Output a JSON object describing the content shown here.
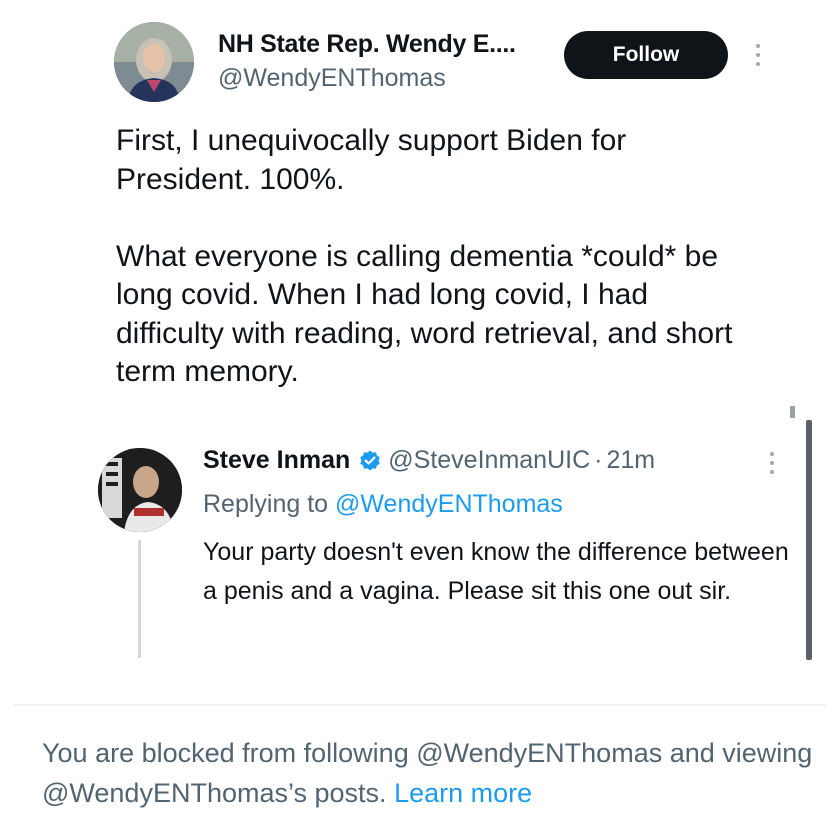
{
  "tweet": {
    "display_name": "NH State Rep. Wendy E....",
    "handle": "@WendyENThomas",
    "follow_label": "Follow",
    "text": "First, I unequivocally support Biden for President. 100%.\n\nWhat everyone is calling dementia *could* be long covid. When I had long covid, I had difficulty with reading, word retrieval, and short term memory."
  },
  "reply": {
    "display_name": "Steve Inman",
    "handle": "@SteveInmanUIC",
    "separator": "·",
    "time": "21m",
    "replying_prefix": "Replying to",
    "replying_to": "@WendyENThomas",
    "text": "Your party doesn't even know the difference between a penis and a vagina. Please sit this one out sir."
  },
  "notice": {
    "text": "You are blocked from following @WendyENThomas and viewing @WendyENThomas’s posts.",
    "link": "Learn more"
  },
  "icons": {
    "verified": "verified-badge-icon",
    "more": "more-options-icon"
  },
  "colors": {
    "text": "#0f1419",
    "secondary": "#536471",
    "link": "#1d9bf0",
    "button_bg": "#0f1419"
  }
}
